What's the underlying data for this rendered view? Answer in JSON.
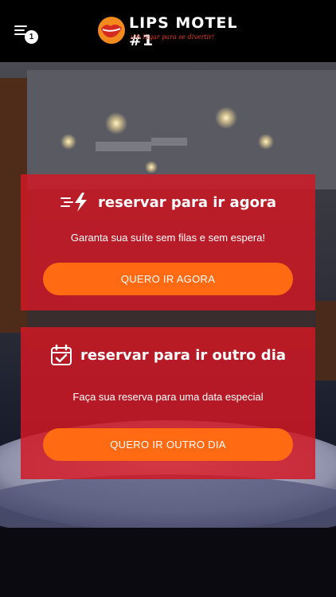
{
  "header": {
    "menu_badge": "1",
    "brand_name": "LIPS MOTEL #1",
    "brand_tagline": "um lugar para se divertir!"
  },
  "cards": [
    {
      "title": "reservar para ir agora",
      "subtitle": "Garanta sua suíte sem filas e sem espera!",
      "button": "QUERO IR AGORA",
      "icon": "lightning-speed-icon"
    },
    {
      "title": "reservar para ir outro dia",
      "subtitle": "Faça sua reserva para uma data especial",
      "button": "QUERO IR OUTRO DIA",
      "icon": "calendar-check-icon"
    }
  ],
  "colors": {
    "card": "#d21824",
    "button": "#ff6a12",
    "header": "#000000",
    "tagline": "#e53a2a"
  }
}
